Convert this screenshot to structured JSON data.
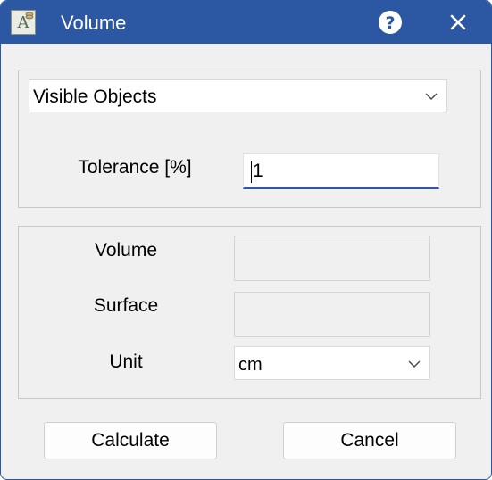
{
  "window": {
    "title": "Volume",
    "app_icon_letter": "A"
  },
  "titlebar": {
    "help_icon": "question-circle-icon",
    "close_icon": "close-icon"
  },
  "filter": {
    "selected": "Visible Objects"
  },
  "tolerance": {
    "label": "Tolerance [%]",
    "value": "1"
  },
  "results": {
    "volume_label": "Volume",
    "volume_value": "",
    "surface_label": "Surface",
    "surface_value": "",
    "unit_label": "Unit",
    "unit_selected": "cm"
  },
  "buttons": {
    "calculate": "Calculate",
    "cancel": "Cancel"
  },
  "colors": {
    "accent": "#2b57a3",
    "background": "#f0f0f0"
  }
}
